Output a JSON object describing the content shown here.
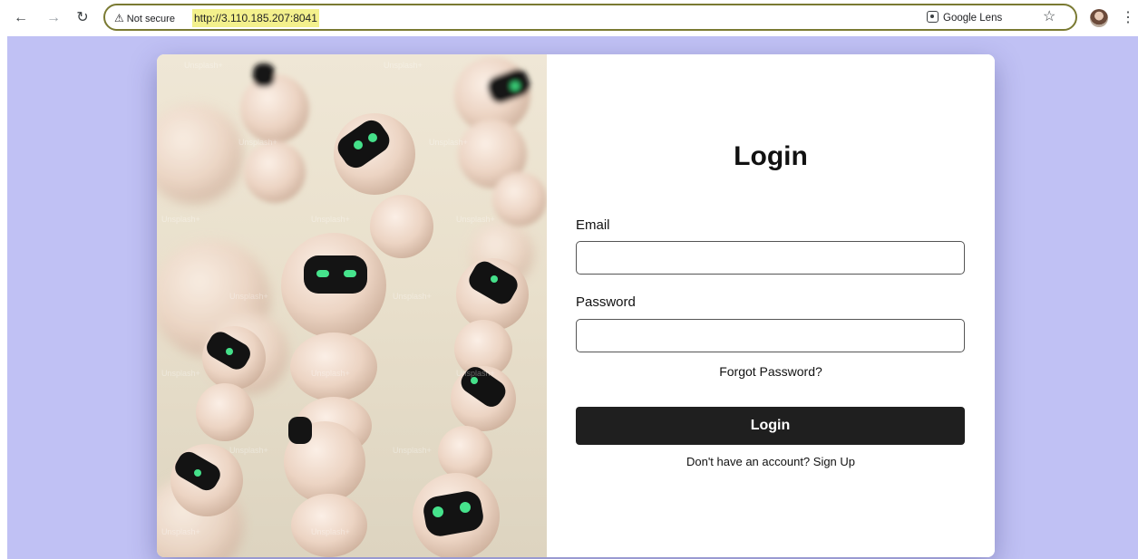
{
  "browser": {
    "security_label": "Not secure",
    "url": "http://3.110.185.207:8041",
    "lens_label": "Google Lens"
  },
  "colors": {
    "page_background": "#c0c1f4",
    "button_background": "#1f1f1f",
    "url_highlight": "#f3f08c"
  },
  "login": {
    "title": "Login",
    "email_label": "Email",
    "email_value": "",
    "password_label": "Password",
    "password_value": "",
    "forgot_password": "Forgot Password?",
    "submit_label": "Login",
    "signup_prompt": "Don't have an account? Sign Up"
  },
  "hero": {
    "watermark": "Unsplash+"
  }
}
